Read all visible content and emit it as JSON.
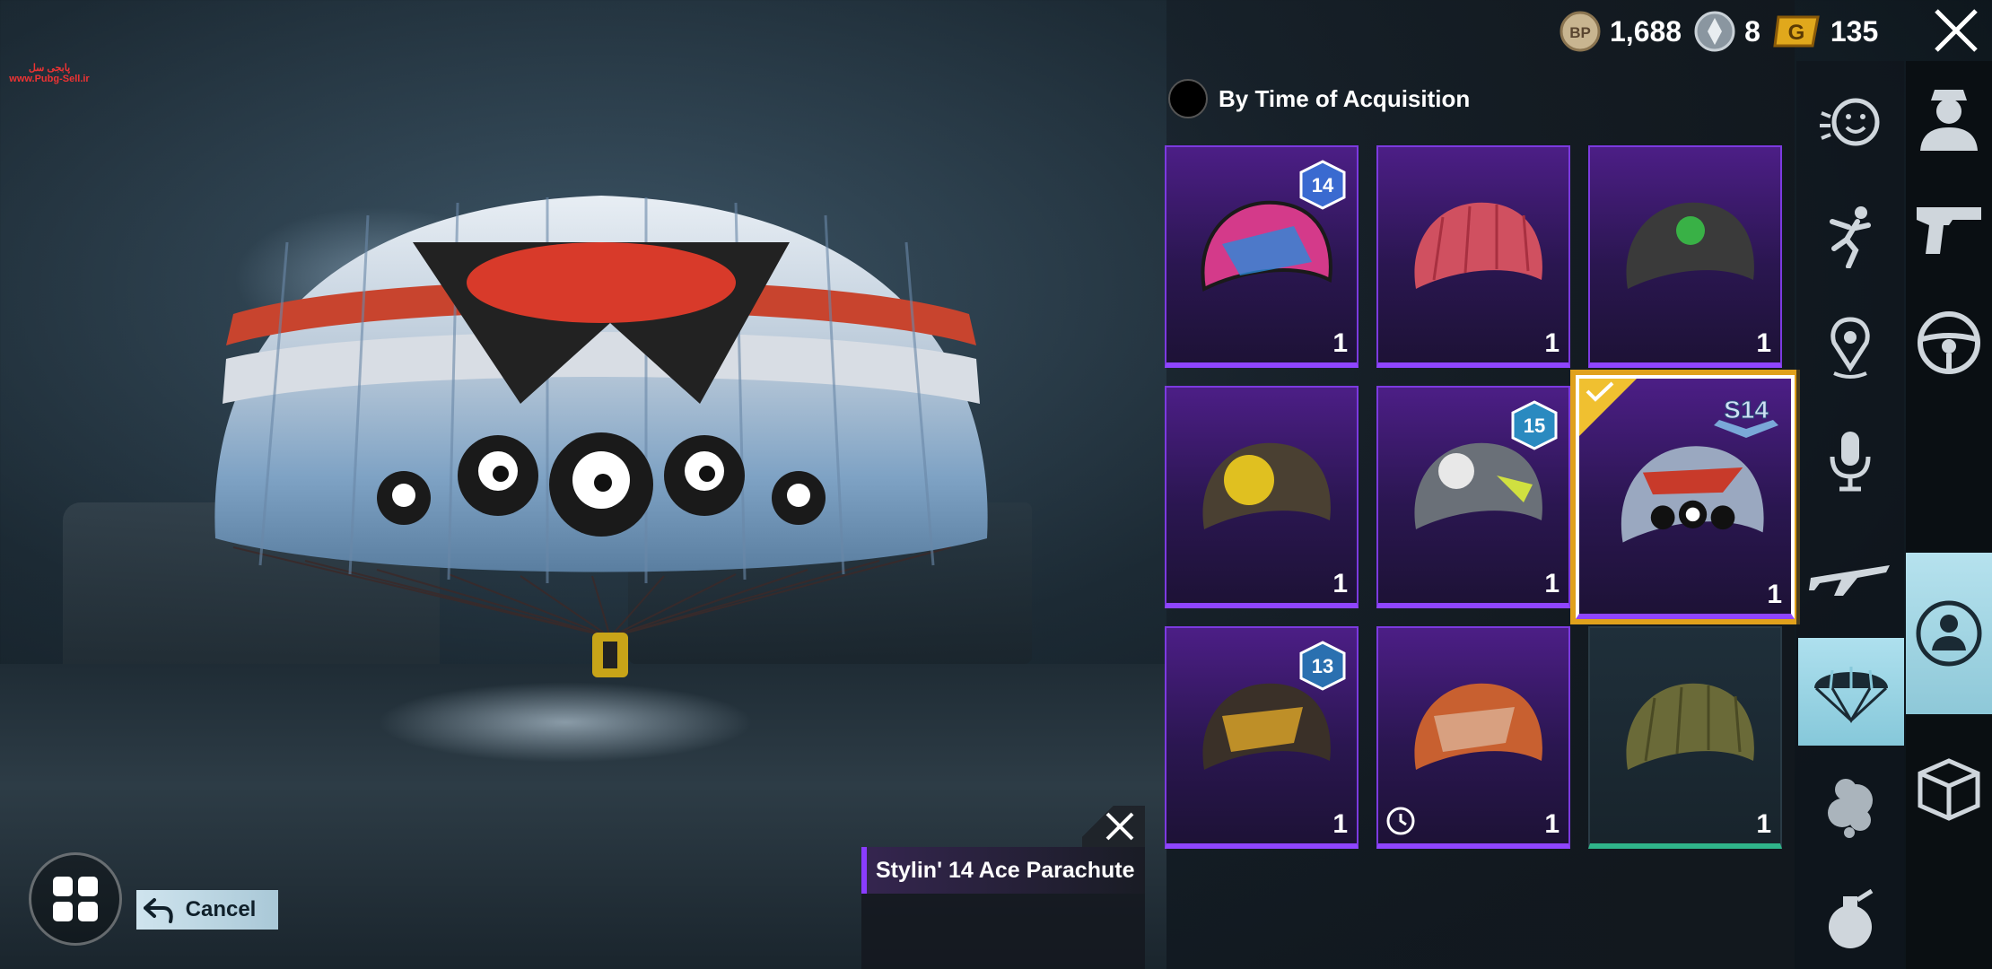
{
  "watermark": {
    "line1": "پابجی سل",
    "line2": "www.Pubg-Sell.ir"
  },
  "currency": {
    "bp": {
      "icon": "bp-coin-icon",
      "label": "BP",
      "value": "1,688"
    },
    "silver": {
      "icon": "silver-fragment-icon",
      "value": "8"
    },
    "gold": {
      "icon": "g-coin-icon",
      "label": "G",
      "value": "135"
    }
  },
  "sort": {
    "label": "By Time of Acquisition"
  },
  "items": [
    {
      "count": "1",
      "badge": "14",
      "color": "#d43a8a"
    },
    {
      "count": "1",
      "color": "#d05060"
    },
    {
      "count": "1",
      "color": "#3a3a3a"
    },
    {
      "count": "1",
      "color": "#4a4032"
    },
    {
      "count": "1",
      "badge": "15",
      "color": "#6a7078"
    },
    {
      "count": "1",
      "badge_text": "S14",
      "color": "#9aa8c0",
      "selected": true
    },
    {
      "count": "1",
      "badge": "13",
      "color": "#3a3028"
    },
    {
      "count": "1",
      "timed": true,
      "color": "#c86030"
    },
    {
      "count": "1",
      "color": "#6a6a38",
      "rarity": "green"
    }
  ],
  "selected_item": {
    "name": "Stylin' 14 Ace Parachute"
  },
  "cancel": {
    "label": "Cancel"
  },
  "categories": [
    "emote-icon",
    "dance-icon",
    "location-icon",
    "voice-icon",
    "plane-icon",
    "parachute-icon",
    "smoke-icon",
    "grenade-icon"
  ],
  "tabs": [
    "character-icon",
    "gun-icon",
    "vehicle-icon",
    "avatar-icon",
    "crate-icon"
  ],
  "colors": {
    "rare_purple": "#8f45ff",
    "selected_gold": "#e0a11c",
    "active_tab": "#aee0ee"
  }
}
